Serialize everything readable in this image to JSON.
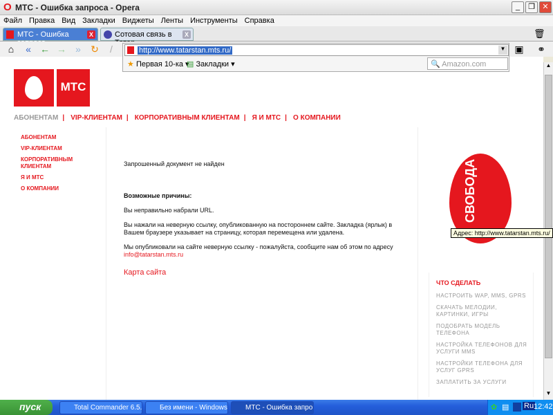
{
  "window": {
    "title": "МТС - Ошибка запроса - Opera"
  },
  "menu": [
    "Файл",
    "Правка",
    "Вид",
    "Закладки",
    "Виджеты",
    "Ленты",
    "Инструменты",
    "Справка"
  ],
  "tabs": [
    {
      "label": "МТС - Ошибка запроса"
    },
    {
      "label": "Сотовая связь в Татар..."
    }
  ],
  "address": {
    "url": "http://www.tatarstan.mts.ru/",
    "search_placeholder": "Amazon.com"
  },
  "bookmarks": {
    "first10": "Первая 10-ка",
    "bookmarks": "Закладки"
  },
  "logo": "МТС",
  "topnav": [
    "АБОНЕНТАМ",
    "VIP-КЛИЕНТАМ",
    "КОРПОРАТИВНЫМ КЛИЕНТАМ",
    "Я И МТС",
    "О КОМПАНИИ"
  ],
  "leftnav": [
    "АБОНЕНТАМ",
    "VIP-КЛИЕНТАМ",
    "КОРПОРАТИВНЫМ КЛИЕНТАМ",
    "Я И МТС",
    "О КОМПАНИИ"
  ],
  "main": {
    "not_found": "Запрошенный документ не найден",
    "reasons_title": "Возможные причины:",
    "r1": "Вы неправильно набрали URL.",
    "r2": "Вы нажали на неверную ссылку, опубликованную на постороннем сайте. Закладка (ярлык) в Вашем браузере указывает на страницу, которая перемещена или удалена.",
    "r3": "Мы опубликовали на сайте неверную ссылку - пожалуйста, сообщите нам об этом по адресу",
    "email": "info@tatarstan.mts.ru",
    "sitemap": "Карта сайта"
  },
  "promo": "СВОБОДА",
  "tooltip": "Адрес: http://www.tatarstan.mts.ru/",
  "todo": {
    "title": "ЧТО СДЕЛАТЬ",
    "items": [
      "НАСТРОИТЬ WAP, MMS, GPRS",
      "СКАЧАТЬ МЕЛОДИИ, КАРТИНКИ, ИГРЫ",
      "ПОДОБРАТЬ МОДЕЛЬ ТЕЛЕФОНА",
      "НАСТРОЙКА ТЕЛЕФОНОВ ДЛЯ УСЛУГИ MMS",
      "НАСТРОЙКИ ТЕЛЕФОНА ДЛЯ УСЛУГ GPRS",
      "ЗАПЛАТИТЬ ЗА УСЛУГИ"
    ]
  },
  "taskbar": {
    "start": "пуск",
    "tasks": [
      "Total Commander 6.5...",
      "Без имени - Windows...",
      "МТС - Ошибка запро..."
    ],
    "lang": "Ru",
    "clock": "12:42"
  }
}
